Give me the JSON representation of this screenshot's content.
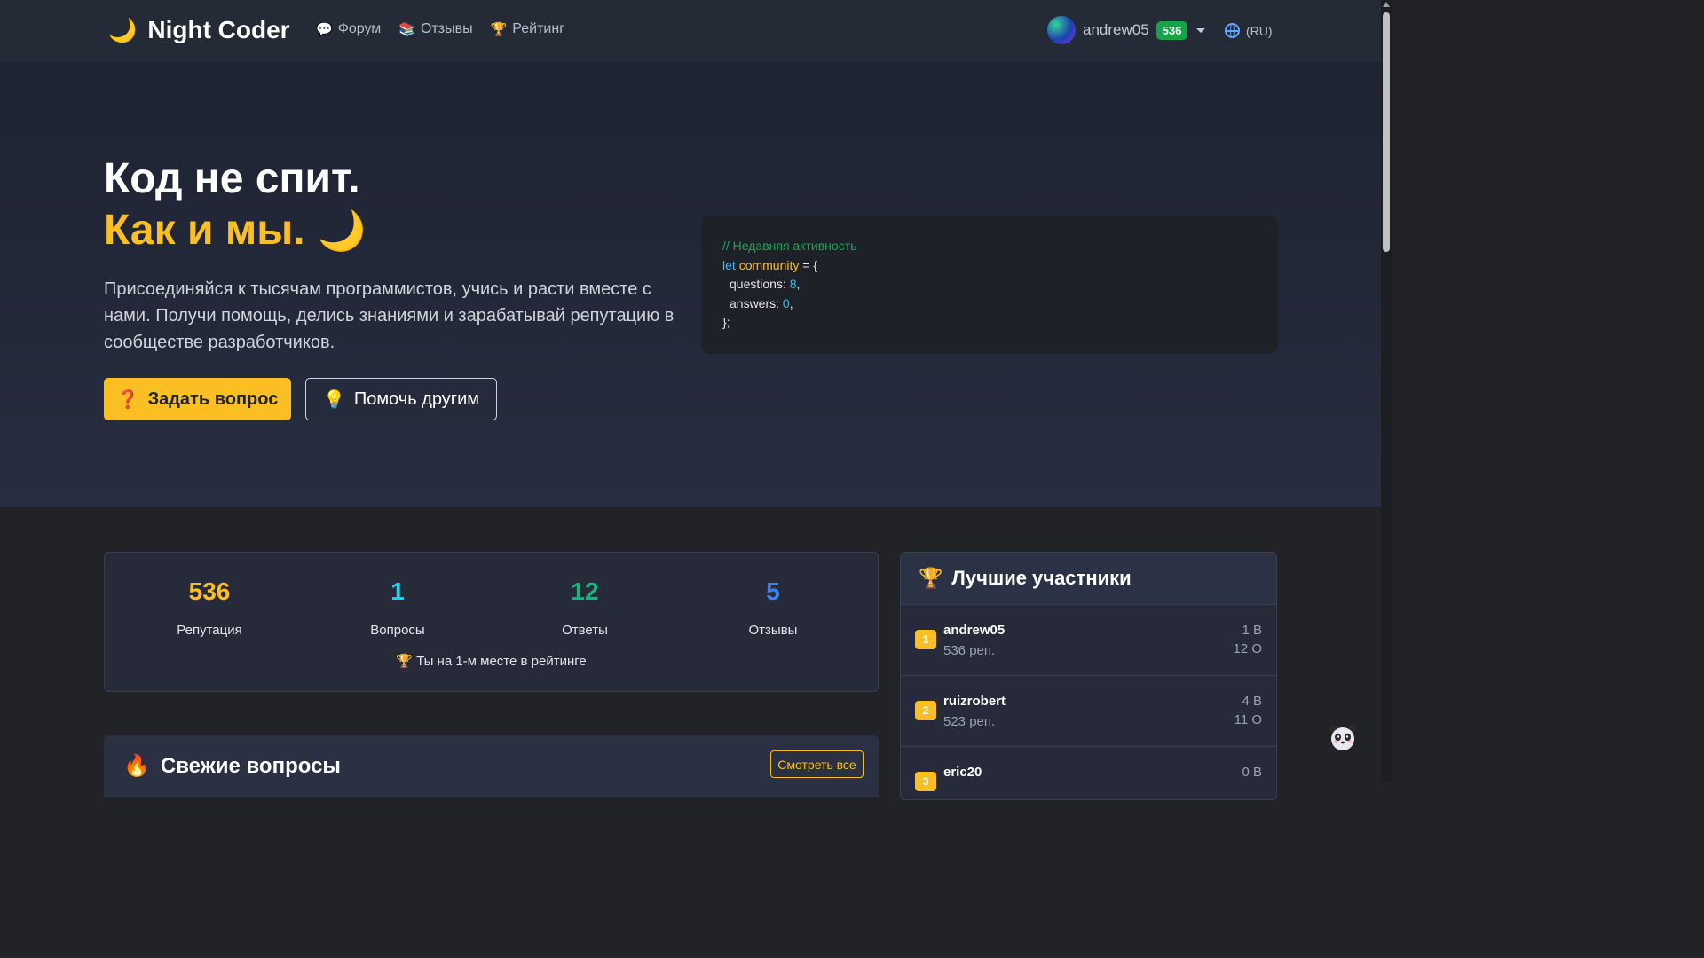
{
  "nav": {
    "brand_icon": "moon-icon",
    "brand": "Night Coder",
    "links": [
      {
        "icon": "speech-bubble-icon",
        "label": "Форум"
      },
      {
        "icon": "books-icon",
        "label": "Отзывы"
      },
      {
        "icon": "trophy-icon",
        "label": "Рейтинг"
      }
    ],
    "user": {
      "name": "andrew05",
      "reputation": "536"
    },
    "lang": "(RU)"
  },
  "hero": {
    "title_line1": "Код не спит.",
    "title_line2": "Как и мы.",
    "description": "Присоединяйся к тысячам программистов, учись и расти вместе с нами. Получи помощь, делись знаниями и зарабатывай репутацию в сообществе разработчиков.",
    "ask_button": "Задать вопрос",
    "help_button": "Помочь другим"
  },
  "code": {
    "comment": "// Недавняя активность",
    "keyword": "let",
    "variable": "community",
    "open": " = {",
    "questions_key": "questions: ",
    "questions_val": "8",
    "answers_key": "answers: ",
    "answers_val": "0",
    "close": "};"
  },
  "stats": {
    "items": [
      {
        "value": "536",
        "label": "Репутация",
        "color": "#fbbf24"
      },
      {
        "value": "1",
        "label": "Вопросы",
        "color": "#22d3ee"
      },
      {
        "value": "12",
        "label": "Ответы",
        "color": "#10b981"
      },
      {
        "value": "5",
        "label": "Отзывы",
        "color": "#3b82f6"
      }
    ],
    "rank_text": "Ты на 1-м месте в рейтинге"
  },
  "fresh": {
    "title": "Свежие вопросы",
    "view_all": "Смотреть все"
  },
  "leaders": {
    "title": "Лучшие участники",
    "rows": [
      {
        "rank": "1",
        "name": "andrew05",
        "rep": "536 реп.",
        "q": "1 В",
        "a": "12 О"
      },
      {
        "rank": "2",
        "name": "ruizrobert",
        "rep": "523 реп.",
        "q": "4 В",
        "a": "11 О"
      },
      {
        "rank": "3",
        "name": "eric20",
        "rep": "",
        "q": "0 В",
        "a": ""
      }
    ]
  }
}
